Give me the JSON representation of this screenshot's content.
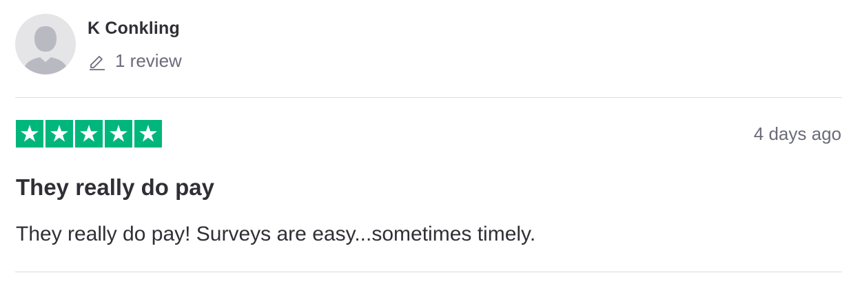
{
  "reviewer": {
    "name": "K Conkling",
    "review_count": "1 review",
    "avatar_icon": "default-user-avatar",
    "count_icon": "pencil-icon"
  },
  "review": {
    "rating": 5,
    "max_rating": 5,
    "star_color": "#00b67a",
    "date": "4 days ago",
    "title": "They really do pay",
    "body": "They really do pay! Surveys are easy...sometimes timely."
  }
}
